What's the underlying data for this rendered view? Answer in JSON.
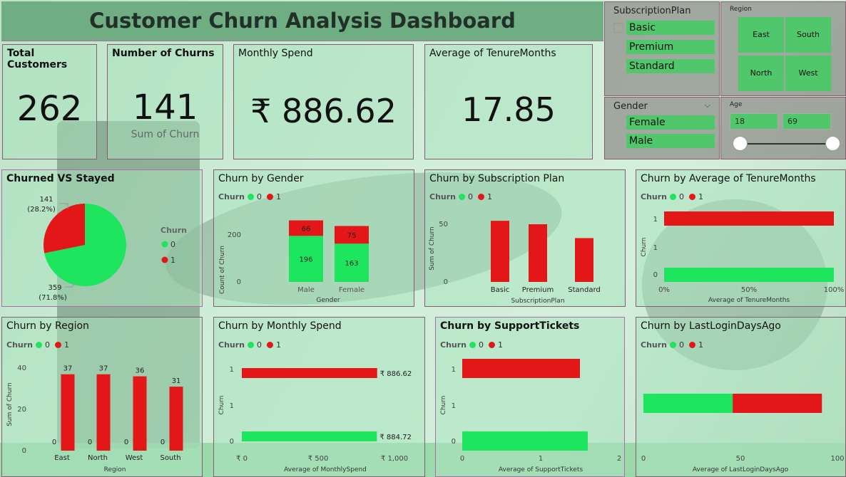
{
  "title": "Customer Churn Analysis Dashboard",
  "colors": {
    "churn0": "#1de65e",
    "churn1": "#e31717",
    "slicer_item": "#4fc76a"
  },
  "kpis": [
    {
      "label": "Total Customers",
      "value": "262"
    },
    {
      "label": "Number of Churns",
      "value": "141",
      "sub": "Sum of Churn"
    },
    {
      "label": "Monthly Spend",
      "value": "₹ 886.62"
    },
    {
      "label": "Average of TenureMonths",
      "value": "17.85"
    }
  ],
  "slicers": {
    "subscription": {
      "title": "SubscriptionPlan",
      "items": [
        "Basic",
        "Premium",
        "Standard"
      ]
    },
    "region": {
      "title": "Region",
      "tiles": [
        "East",
        "South",
        "North",
        "West"
      ]
    },
    "gender": {
      "title": "Gender",
      "items": [
        "Female",
        "Male"
      ]
    },
    "age": {
      "title": "Age",
      "min": "18",
      "max": "69"
    }
  },
  "legend": {
    "title": "Churn",
    "v0": "0",
    "v1": "1"
  },
  "charts": {
    "pie": {
      "title": "Churned VS Stayed",
      "legend_title": "Churn",
      "legend0": "0",
      "legend1": "1",
      "label1a": "141",
      "label1b": "(28.2%)",
      "label0a": "359",
      "label0b": "(71.8%)"
    },
    "gender": {
      "title": "Churn by Gender",
      "ylabel": "Count of Churn",
      "xlabel": "Gender",
      "ytick_200": "200",
      "ytick_0": "0"
    },
    "sub": {
      "title": "Churn by Subscription Plan",
      "ylabel": "Sum of Churn",
      "xlabel": "SubscriptionPlan",
      "ytick_50": "50",
      "ytick_0": "0"
    },
    "tenure": {
      "title": "Churn by Average of TenureMonths",
      "ylabel": "Churn",
      "xlabel": "Average of TenureMonths",
      "y1": "1",
      "y_mid": "1",
      "y0": "0",
      "x0": "0%",
      "x50": "50%",
      "x100": "100%"
    },
    "region": {
      "title": "Churn by Region",
      "ylabel": "Sum of Churn",
      "xlabel": "Region",
      "ytick_40": "40",
      "ytick_20": "20",
      "ytick_0": "0"
    },
    "spend": {
      "title": "Churn by Monthly Spend",
      "ylabel": "Churn",
      "xlabel": "Average of MonthlySpend",
      "y1": "1",
      "y_mid": "1",
      "y0": "0",
      "x0": "₹ 0",
      "x500": "₹ 500",
      "x1000": "₹ 1,000"
    },
    "tickets": {
      "title": "Churn by SupportTickets",
      "ylabel": "Churn",
      "xlabel": "Average of SupportTickets",
      "y1": "1",
      "y_mid": "1",
      "y0": "0",
      "x0": "0",
      "x1": "1",
      "x2": "2"
    },
    "login": {
      "title": "Churn by LastLoginDaysAgo",
      "xlabel": "Average of LastLoginDaysAgo",
      "x0": "0",
      "x50": "50",
      "x100": "100"
    }
  },
  "chart_data": [
    {
      "type": "pie",
      "title": "Churned VS Stayed",
      "legend_title": "Churn",
      "slices": [
        {
          "label": "0",
          "value": 359,
          "pct": 71.8
        },
        {
          "label": "1",
          "value": 141,
          "pct": 28.2
        }
      ]
    },
    {
      "type": "bar",
      "title": "Churn by Gender",
      "xlabel": "Gender",
      "ylabel": "Count of Churn",
      "categories": [
        "Male",
        "Female"
      ],
      "series": [
        {
          "name": "0",
          "values": [
            196,
            163
          ]
        },
        {
          "name": "1",
          "values": [
            66,
            75
          ]
        }
      ],
      "stacked": true,
      "ylim": [
        0,
        300
      ]
    },
    {
      "type": "bar",
      "title": "Churn by Subscription Plan",
      "xlabel": "SubscriptionPlan",
      "ylabel": "Sum of Churn",
      "categories": [
        "Basic",
        "Premium",
        "Standard"
      ],
      "series": [
        {
          "name": "1",
          "values": [
            53,
            50,
            38
          ]
        }
      ],
      "ylim": [
        0,
        60
      ]
    },
    {
      "type": "bar",
      "orientation": "horizontal",
      "title": "Churn by Average of TenureMonths",
      "xlabel": "Average of TenureMonths",
      "ylabel": "Churn",
      "categories": [
        "1",
        "0"
      ],
      "series": [
        {
          "name": "1",
          "values": [
            100
          ]
        },
        {
          "name": "0",
          "values": [
            100
          ]
        }
      ],
      "xlim": [
        0,
        100
      ]
    },
    {
      "type": "bar",
      "title": "Churn by Region",
      "xlabel": "Region",
      "ylabel": "Sum of Churn",
      "categories": [
        "East",
        "North",
        "West",
        "South"
      ],
      "series": [
        {
          "name": "0",
          "values": [
            0,
            0,
            0,
            0
          ]
        },
        {
          "name": "1",
          "values": [
            37,
            37,
            36,
            31
          ]
        }
      ],
      "ylim": [
        0,
        45
      ]
    },
    {
      "type": "bar",
      "orientation": "horizontal",
      "title": "Churn by Monthly Spend",
      "xlabel": "Average of MonthlySpend",
      "ylabel": "Churn",
      "categories": [
        "1",
        "0"
      ],
      "series": [
        {
          "name": "1",
          "values": [
            886.62
          ]
        },
        {
          "name": "0",
          "values": [
            884.72
          ]
        }
      ],
      "data_labels": [
        "₹ 886.62",
        "₹ 884.72"
      ],
      "xlim": [
        0,
        1000
      ]
    },
    {
      "type": "bar",
      "orientation": "horizontal",
      "title": "Churn by SupportTickets",
      "xlabel": "Average of SupportTickets",
      "ylabel": "Churn",
      "categories": [
        "1",
        "0"
      ],
      "series": [
        {
          "name": "1",
          "values": [
            1.5
          ]
        },
        {
          "name": "0",
          "values": [
            1.6
          ]
        }
      ],
      "xlim": [
        0,
        2
      ]
    },
    {
      "type": "bar",
      "orientation": "horizontal",
      "stacked": true,
      "title": "Churn by LastLoginDaysAgo",
      "xlabel": "Average of LastLoginDaysAgo",
      "series": [
        {
          "name": "0",
          "values": [
            46
          ]
        },
        {
          "name": "1",
          "values": [
            46
          ]
        }
      ],
      "xlim": [
        0,
        100
      ]
    }
  ]
}
